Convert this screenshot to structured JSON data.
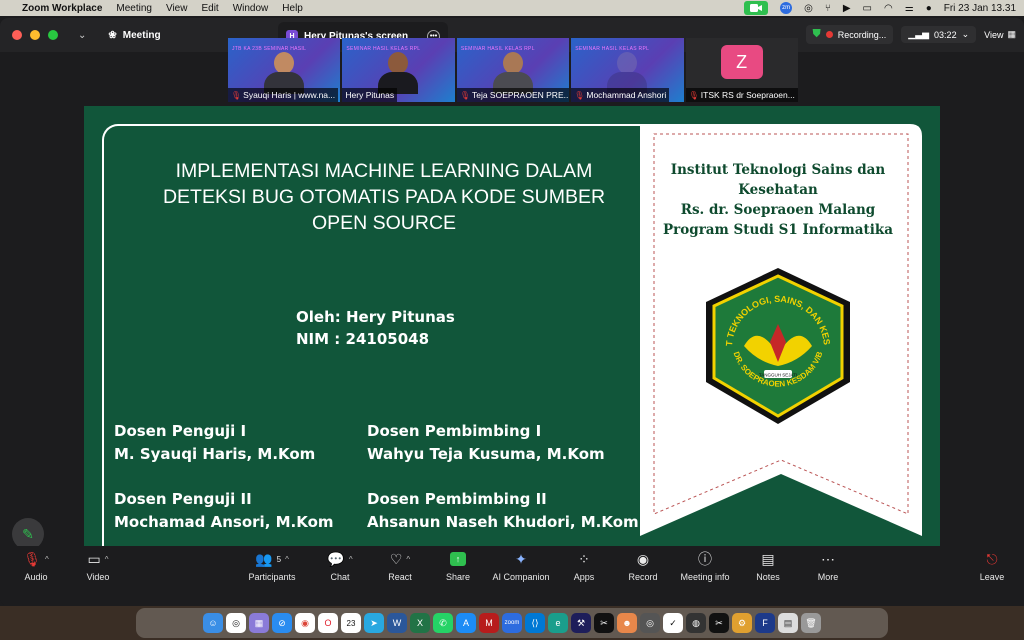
{
  "menubar": {
    "app_name": "Zoom Workplace",
    "menus": [
      "Meeting",
      "View",
      "Edit",
      "Window",
      "Help"
    ],
    "clock": "Fri 23 Jan  13.31"
  },
  "titlebar": {
    "meeting_label": "Meeting",
    "tab_title": "Hery Pitunas's screen",
    "tab_icon_letter": "H",
    "recording_label": "Recording...",
    "timer": "03:22",
    "view_label": "View"
  },
  "participants": [
    {
      "name": "Syauqi Haris | www.na...",
      "banner": "JTB KA 23B   SEMINAR HASIL"
    },
    {
      "name": "Hery Pitunas",
      "banner": "SEMINAR HASIL   KELAS RPL"
    },
    {
      "name": "Teja SOEPRAOEN PRE...",
      "banner": "SEMINAR HASIL   KELAS RPL"
    },
    {
      "name": "Mochammad Anshori",
      "banner": "SEMINAR HASIL   KELAS RPL"
    },
    {
      "name": "ITSK RS dr Soepraoen...",
      "avatar_letter": "Z"
    }
  ],
  "slide": {
    "title_lines": [
      "IMPLEMENTASI MACHINE LEARNING DALAM",
      "DETEKSI BUG OTOMATIS PADA KODE SUMBER",
      "OPEN SOURCE"
    ],
    "author_line": "Oleh: Hery Pitunas",
    "nim_line": "NIM : 24105048",
    "examiner1_role": "Dosen Penguji I",
    "examiner1_name": "M. Syauqi Haris, M.Kom",
    "advisor1_role": "Dosen Pembimbing I",
    "advisor1_name": "Wahyu Teja Kusuma, M.Kom",
    "examiner2_role": "Dosen Penguji II",
    "examiner2_name": "Mochamad Ansori, M.Kom",
    "advisor2_role": "Dosen Pembimbing II",
    "advisor2_name": "Ahsanun Naseh Khudori, M.Kom",
    "institution_lines": [
      "Institut Teknologi Sains dan Kesehatan",
      "Rs. dr. Soepraoen Malang",
      "Program Studi S1 Informatika"
    ],
    "logo_text_top": "INSTITUT TEKNOLOGI, SAINS, DAN KESEHATAN",
    "logo_text_bottom": "RS DR. SOEPRAOEN KESDAM V/BRW",
    "logo_motto": "TANGGUH SEJATI"
  },
  "toolbar": {
    "audio": "Audio",
    "video": "Video",
    "participants": "Participants",
    "participants_count": "5",
    "chat": "Chat",
    "react": "React",
    "share": "Share",
    "ai_companion": "AI Companion",
    "apps": "Apps",
    "record": "Record",
    "meeting_info": "Meeting info",
    "notes": "Notes",
    "more": "More",
    "leave": "Leave"
  },
  "dock": {
    "calendar_day": "23",
    "apps": [
      "finder-icon",
      "chatgpt-icon",
      "launchpad-icon",
      "safari-icon",
      "chrome-icon",
      "opera-icon",
      "calendar-icon",
      "telegram-icon",
      "word-icon",
      "excel-icon",
      "whatsapp-icon",
      "appstore-icon",
      "mendeley-icon",
      "zoom-icon",
      "vscode-icon",
      "edge-icon",
      "xcode-icon",
      "capcut-icon",
      "game-icon",
      "chatgpt2-icon",
      "notes-icon",
      "camera-icon",
      "capcut2-icon",
      "appstore2-icon",
      "flow-icon",
      "doc-icon",
      "trash-icon"
    ]
  },
  "colors": {
    "slide_green": "#11563a",
    "record_red": "#e53935",
    "zoom_green": "#2fbf4f",
    "avatar_pink": "#e84a82"
  }
}
